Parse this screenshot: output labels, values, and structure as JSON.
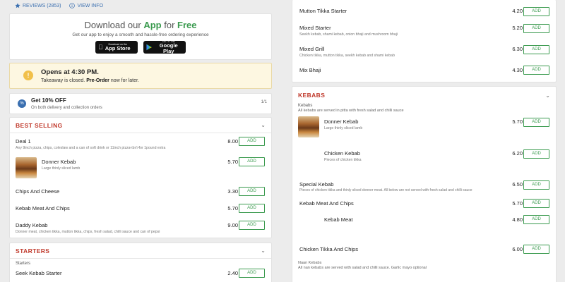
{
  "topbar": {
    "reviews": "REVIEWS (2853)",
    "view_info": "VIEW INFO"
  },
  "app_banner": {
    "title_prefix": "Download our ",
    "title_highlight": "App",
    "title_middle": " for ",
    "title_suffix": "Free",
    "subtitle": "Get our app to enjoy a smooth and hassle-free ordering experience",
    "appstore_small": "Download on the",
    "appstore_big": "App Store",
    "googleplay_small": "GET IT ON",
    "googleplay_big": "Google Play"
  },
  "opens": {
    "icon": "!",
    "title": "Opens at 4:30 PM.",
    "text_before": "Takeaway is closed. ",
    "text_bold": "Pre-Order",
    "text_after": " now for later."
  },
  "offer": {
    "icon": "%",
    "title": "Get 10% OFF",
    "subtitle": "On both delivery and collection orders",
    "pager": "1/1"
  },
  "add_label": "ADD",
  "best_selling": {
    "title": "BEST SELLING",
    "items": [
      {
        "name": "Deal 1",
        "desc": "Any 9inch pizza, chips, coleslaw and a can of soft drink or 11inch pizza<br/>for 1pound extra",
        "price": "8.00"
      },
      {
        "name": "Donner Kebab",
        "desc": "Large thinly sliced lamb",
        "price": "5.70"
      },
      {
        "name": "Chips And Cheese",
        "desc": "",
        "price": "3.30"
      },
      {
        "name": "Kebab Meat And Chips",
        "desc": "",
        "price": "5.70"
      },
      {
        "name": "Daddy Kebab",
        "desc": "Donner meat, chicken tikka, mutton tikka, chips, fresh salad, chilli sauce and can of pepsi",
        "price": "9.00"
      }
    ]
  },
  "starters": {
    "title": "STARTERS",
    "note": "Starters",
    "items": [
      {
        "name": "Seek Kebab Starter",
        "price": "2.40"
      }
    ]
  },
  "right_top": {
    "items": [
      {
        "name": "Mutton Tikka Starter",
        "desc": "",
        "price": "4.20"
      },
      {
        "name": "Mixed Starter",
        "desc": "Seekh kebab, shami kebab, onion bhaji and mushroom bhaji",
        "price": "5.20"
      },
      {
        "name": "Mixed Grill",
        "desc": "Chicken tikka, mutton tikka, seekh kebab and shami kebab",
        "price": "6.30"
      },
      {
        "name": "Mix Bhaji",
        "desc": "",
        "price": "4.30"
      }
    ]
  },
  "kebabs": {
    "title": "KEBABS",
    "note": "Kebabs",
    "note2": "All kebabs are served in pitta with fresh salad and chilli sauce",
    "items": [
      {
        "name": "Donner Kebab",
        "desc": "Large thinly sliced lamb",
        "price": "5.70"
      },
      {
        "name": "Chicken Kebab",
        "desc": "Pieces of chicken tikka",
        "price": "6.20"
      },
      {
        "name": "Special Kebab",
        "desc": "Pieces of chicken tikka and thinly sliced donner meat. All below are not served with fresh salad and chilli sauce",
        "price": "6.50"
      },
      {
        "name": "Kebab Meat And Chips",
        "desc": "",
        "price": "5.70"
      },
      {
        "name": "Kebab Meat",
        "desc": "",
        "price": "4.80"
      },
      {
        "name": "Chicken Tikka And Chips",
        "desc": "",
        "price": "6.00"
      }
    ],
    "naan_note": "Naan Kebabs",
    "naan_note2": "All nan kebabs are served with salad and chilli sauce. Garlic mayo optional"
  },
  "colors": {
    "accent_green": "#3a9a4e",
    "section_red": "#c0392b",
    "link_blue": "#3a6fb0",
    "notice_yellow": "#fdf7e1"
  },
  "icons": [
    "star-icon",
    "info-icon",
    "apple-icon",
    "google-play-icon",
    "clock-alert-icon",
    "percent-icon",
    "chevron-down-icon"
  ]
}
